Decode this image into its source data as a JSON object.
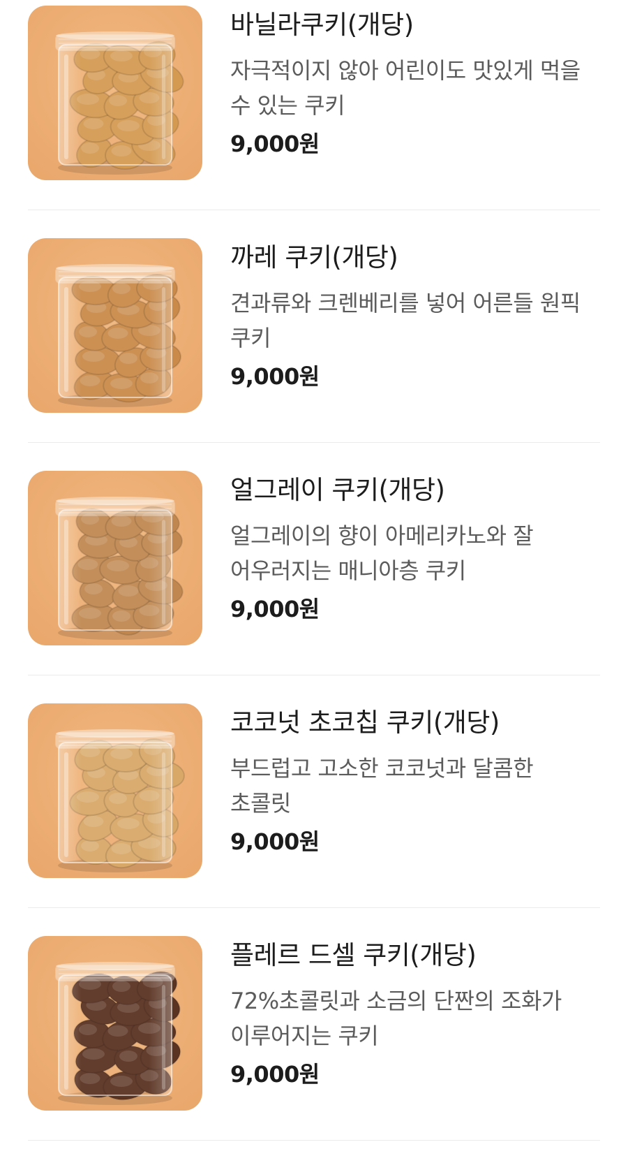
{
  "menu": {
    "items": [
      {
        "name": "바닐라쿠키(개당)",
        "description": "자극적이지 않아 어린이도 맛있게 먹을 수 있는 쿠키",
        "price": "9,000원",
        "image_icon": "vanilla-cookie-jar-photo",
        "cookie_color": "#d49a52"
      },
      {
        "name": "까레 쿠키(개당)",
        "description": "견과류와 크렌베리를 넣어 어른들 원픽 쿠키",
        "price": "9,000원",
        "image_icon": "carre-cookie-jar-photo",
        "cookie_color": "#c98a4a"
      },
      {
        "name": "얼그레이 쿠키(개당)",
        "description": "얼그레이의 향이 아메리카노와 잘 어우러지는 매니아층 쿠키",
        "price": "9,000원",
        "image_icon": "earl-grey-cookie-jar-photo",
        "cookie_color": "#c08850"
      },
      {
        "name": "코코넛 초코칩 쿠키(개당)",
        "description": "부드럽고 고소한 코코넛과 달콤한 초콜릿",
        "price": "9,000원",
        "image_icon": "coconut-chocochip-cookie-jar-photo",
        "cookie_color": "#d8a868"
      },
      {
        "name": "플레르 드셀 쿠키(개당)",
        "description": "72%초콜릿과 소금의 단짠의 조화가 이루어지는 쿠키",
        "price": "9,000원",
        "image_icon": "fleur-de-sel-cookie-jar-photo",
        "cookie_color": "#5a3322"
      }
    ]
  },
  "colors": {
    "background": "#ffffff",
    "photo_backdrop": "#e9a76c",
    "divider": "#ebebeb",
    "description_text": "#5b5b5b"
  }
}
